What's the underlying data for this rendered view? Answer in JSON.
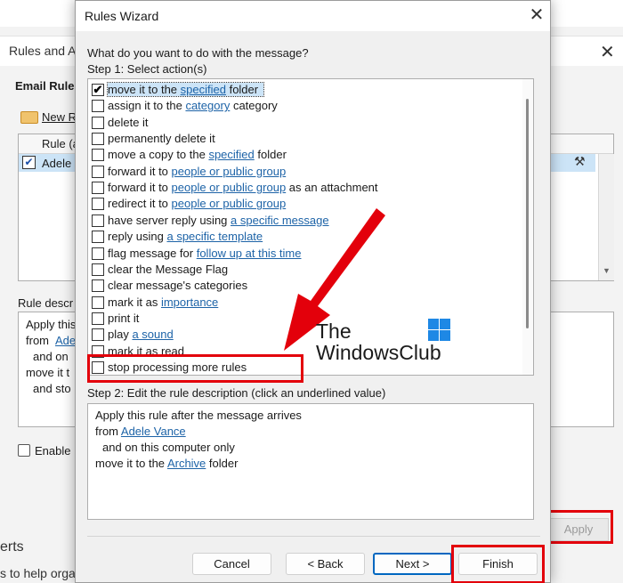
{
  "background_window": {
    "title": "Rules and A",
    "tab_label": "Email Rules",
    "new_rule_label": "New R",
    "column_rule": "Rule (a",
    "row_name": "Adele",
    "description_label": "Rule descr",
    "description_lines": [
      "Apply this",
      "from",
      "Adel",
      "and on",
      "move it t",
      "and sto"
    ],
    "enable_label": "Enable",
    "apply_label": "Apply",
    "bottom_title": "erts",
    "bottom_text": "s to help orga"
  },
  "dialog": {
    "title": "Rules Wizard",
    "question": "What do you want to do with the message?",
    "step1_label": "Step 1: Select action(s)",
    "step2_label": "Step 2: Edit the rule description (click an underlined value)",
    "actions": [
      {
        "pre": "move it to the ",
        "link": "specified",
        "post": " folder",
        "checked": true,
        "selected": true
      },
      {
        "pre": "assign it to the ",
        "link": "category",
        "post": " category",
        "checked": false
      },
      {
        "pre": "delete it",
        "link": "",
        "post": "",
        "checked": false
      },
      {
        "pre": "permanently delete it",
        "link": "",
        "post": "",
        "checked": false
      },
      {
        "pre": "move a copy to the ",
        "link": "specified",
        "post": " folder",
        "checked": false
      },
      {
        "pre": "forward it to ",
        "link": "people or public group",
        "post": "",
        "checked": false
      },
      {
        "pre": "forward it to ",
        "link": "people or public group",
        "post": " as an attachment",
        "checked": false
      },
      {
        "pre": "redirect it to ",
        "link": "people or public group",
        "post": "",
        "checked": false
      },
      {
        "pre": "have server reply using ",
        "link": "a specific message",
        "post": "",
        "checked": false
      },
      {
        "pre": "reply using ",
        "link": "a specific template",
        "post": "",
        "checked": false
      },
      {
        "pre": "flag message for ",
        "link": "follow up at this time",
        "post": "",
        "checked": false
      },
      {
        "pre": "clear the Message Flag",
        "link": "",
        "post": "",
        "checked": false
      },
      {
        "pre": "clear message's categories",
        "link": "",
        "post": "",
        "checked": false
      },
      {
        "pre": "mark it as ",
        "link": "importance",
        "post": "",
        "checked": false
      },
      {
        "pre": "print it",
        "link": "",
        "post": "",
        "checked": false
      },
      {
        "pre": "play ",
        "link": "a sound",
        "post": "",
        "checked": false
      },
      {
        "pre": "mark it as read",
        "link": "",
        "post": "",
        "checked": false
      },
      {
        "pre": "stop processing more rules",
        "link": "",
        "post": "",
        "checked": false
      }
    ],
    "description": {
      "line1": "Apply this rule after the message arrives",
      "line2_pre": "from ",
      "line2_link": "Adele Vance",
      "line3": "and on this computer only",
      "line4_pre": "move it to the ",
      "line4_link": "Archive",
      "line4_post": " folder"
    },
    "buttons": {
      "cancel": "Cancel",
      "back": "< Back",
      "next": "Next >",
      "finish": "Finish"
    }
  },
  "watermark": {
    "line1": "The",
    "line2": "WindowsClub"
  },
  "colors": {
    "highlight": "#e3000b",
    "link": "#1d63a7",
    "selection": "#cce4f7",
    "default_button": "#0067c0"
  }
}
